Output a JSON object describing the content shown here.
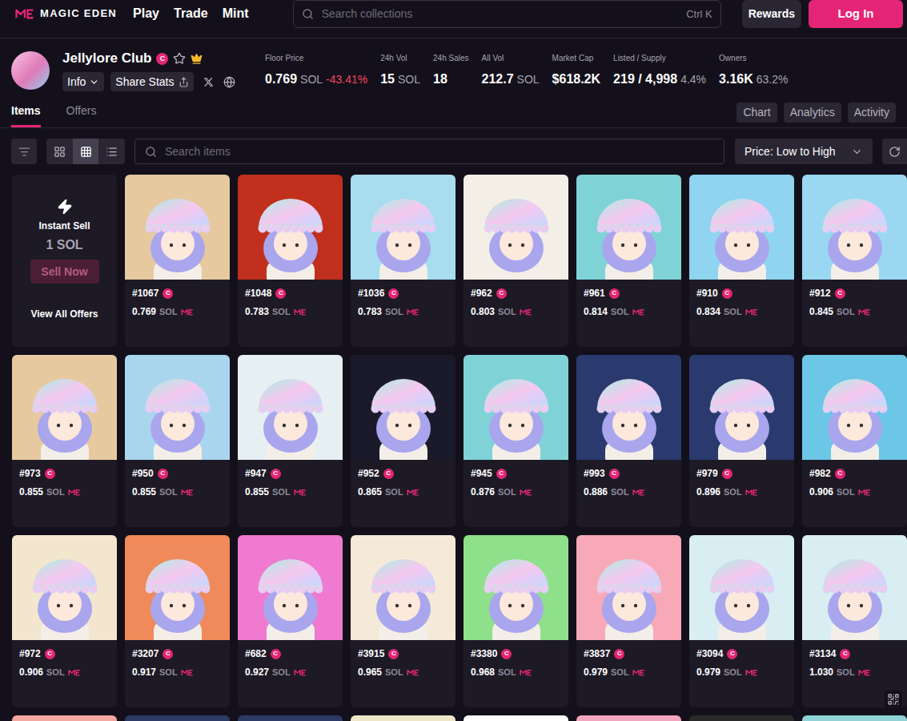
{
  "nav": {
    "brand": "MAGIC EDEN",
    "links": [
      "Play",
      "Trade",
      "Mint"
    ],
    "search": {
      "placeholder": "Search collections",
      "shortcut": "Ctrl K"
    },
    "rewards": "Rewards",
    "login": "Log In"
  },
  "collection": {
    "name": "Jellylore Club",
    "badge": "C",
    "favorited": false,
    "info": "Info",
    "share": "Share Stats",
    "stats": [
      {
        "label": "Floor Price",
        "value": "0.769",
        "suffix": "SOL",
        "change": "-43.41%"
      },
      {
        "label": "24h Vol",
        "value": "15",
        "suffix": "SOL",
        "change": ""
      },
      {
        "label": "24h Sales",
        "value": "18",
        "suffix": "",
        "change": ""
      },
      {
        "label": "All Vol",
        "value": "212.7",
        "suffix": "SOL",
        "change": ""
      },
      {
        "label": "Market Cap",
        "value": "$618.2K",
        "suffix": "",
        "change": ""
      },
      {
        "label": "Listed / Supply",
        "value": "219 / 4,998",
        "suffix": "4.4%",
        "change": ""
      },
      {
        "label": "Owners",
        "value": "3.16K",
        "suffix": "63.2%",
        "change": ""
      }
    ]
  },
  "tabs": [
    {
      "label": "Items",
      "selected": true
    },
    {
      "label": "Offers",
      "selected": false
    }
  ],
  "panel_buttons": [
    "Chart",
    "Analytics",
    "Activity"
  ],
  "toolbar": {
    "views": [
      {
        "view": "large",
        "selected": false
      },
      {
        "view": "small",
        "selected": true
      },
      {
        "view": "list",
        "selected": false
      }
    ],
    "search": {
      "placeholder": "Search items"
    },
    "sort": "Price: Low to High"
  },
  "instant_sell": {
    "title": "Instant Sell",
    "price": "1 SOL",
    "button": "Sell Now",
    "button_disabled": true,
    "link": "View All Offers"
  },
  "items": [
    {
      "id": "#1067",
      "price": "0.769",
      "unit": "SOL",
      "color": "#e7c9a0"
    },
    {
      "id": "#1048",
      "price": "0.783",
      "unit": "SOL",
      "color": "#c0301c"
    },
    {
      "id": "#1036",
      "price": "0.783",
      "unit": "SOL",
      "color": "#a8dcef"
    },
    {
      "id": "#962",
      "price": "0.803",
      "unit": "SOL",
      "color": "#f4efe6"
    },
    {
      "id": "#961",
      "price": "0.814",
      "unit": "SOL",
      "color": "#7fd3d6"
    },
    {
      "id": "#910",
      "price": "0.834",
      "unit": "SOL",
      "color": "#8fd4f0"
    },
    {
      "id": "#912",
      "price": "0.845",
      "unit": "SOL",
      "color": "#9ad8f2"
    },
    {
      "id": "#973",
      "price": "0.855",
      "unit": "SOL",
      "color": "#e7c9a0"
    },
    {
      "id": "#950",
      "price": "0.855",
      "unit": "SOL",
      "color": "#a9d6ee"
    },
    {
      "id": "#947",
      "price": "0.855",
      "unit": "SOL",
      "color": "#e6f0f2"
    },
    {
      "id": "#952",
      "price": "0.865",
      "unit": "SOL",
      "color": "#1a1a2a"
    },
    {
      "id": "#945",
      "price": "0.876",
      "unit": "SOL",
      "color": "#7fd3d6"
    },
    {
      "id": "#993",
      "price": "0.886",
      "unit": "SOL",
      "color": "#2a3a6e"
    },
    {
      "id": "#979",
      "price": "0.896",
      "unit": "SOL",
      "color": "#2a3a6e"
    },
    {
      "id": "#982",
      "price": "0.906",
      "unit": "SOL",
      "color": "#6cc6e6"
    },
    {
      "id": "#972",
      "price": "0.906",
      "unit": "SOL",
      "color": "#f3e6cf"
    },
    {
      "id": "#3207",
      "price": "0.917",
      "unit": "SOL",
      "color": "#f08a5a"
    },
    {
      "id": "#682",
      "price": "0.927",
      "unit": "SOL",
      "color": "#f07ad0"
    },
    {
      "id": "#3915",
      "price": "0.965",
      "unit": "SOL",
      "color": "#f5ead8"
    },
    {
      "id": "#3380",
      "price": "0.968",
      "unit": "SOL",
      "color": "#8fe08a"
    },
    {
      "id": "#3837",
      "price": "0.979",
      "unit": "SOL",
      "color": "#f7a9b8"
    },
    {
      "id": "#3094",
      "price": "0.979",
      "unit": "SOL",
      "color": "#d8eef2"
    },
    {
      "id": "#3134",
      "price": "1.030",
      "unit": "SOL",
      "color": "#d8eef2"
    }
  ],
  "partial_row": [
    {
      "color": "#f3a7a0"
    },
    {
      "color": "#2d3a66"
    },
    {
      "color": "#2d3a66"
    },
    {
      "color": "#efe6c8"
    },
    {
      "color": "#ffffff"
    },
    {
      "color": "#f4a6c0"
    },
    {
      "color": "#2a2a2a"
    },
    {
      "color": "#8fd3d6"
    }
  ]
}
